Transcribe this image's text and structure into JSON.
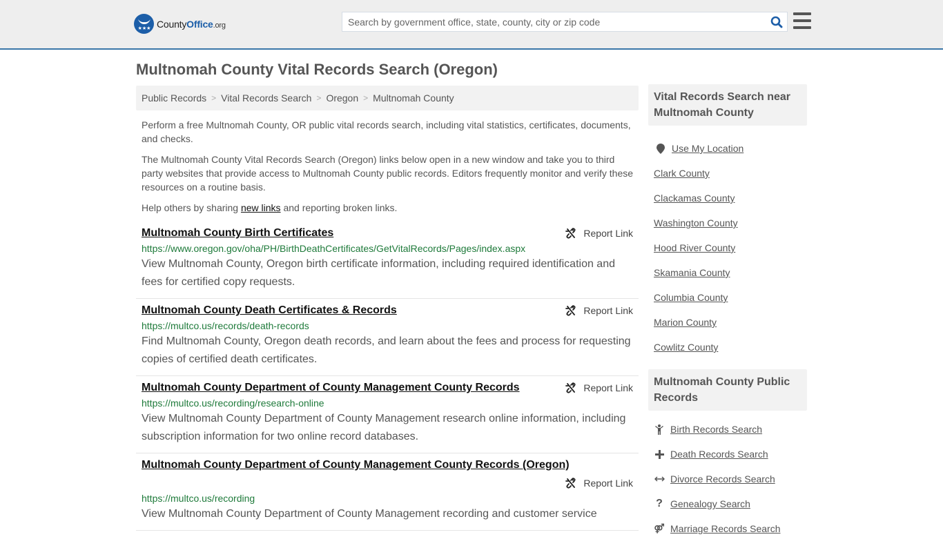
{
  "header": {
    "logo_text_a": "County",
    "logo_text_b": "Office",
    "logo_text_c": ".org",
    "search_placeholder": "Search by government office, state, county, city or zip code",
    "search_value": "",
    "brand_color": "#1c5ea8",
    "accent_border": "#3a77a8"
  },
  "page_title": "Multnomah County Vital Records Search (Oregon)",
  "breadcrumb": [
    "Public Records",
    "Vital Records Search",
    "Oregon",
    "Multnomah County"
  ],
  "intro": {
    "p1": "Perform a free Multnomah County, OR public vital records search, including vital statistics, certificates, documents, and checks.",
    "p2": "The Multnomah County Vital Records Search (Oregon) links below open in a new window and take you to third party websites that provide access to Multnomah County public records. Editors frequently monitor and verify these resources on a routine basis.",
    "p3_before": "Help others by sharing ",
    "p3_link": "new links",
    "p3_after": " and reporting broken links."
  },
  "report_label": "Report Link",
  "results": [
    {
      "title": "Multnomah County Birth Certificates",
      "url": "https://www.oregon.gov/oha/PH/BirthDeathCertificates/GetVitalRecords/Pages/index.aspx",
      "desc": "View Multnomah County, Oregon birth certificate information, including required identification and fees for certified copy requests."
    },
    {
      "title": "Multnomah County Death Certificates & Records",
      "url": "https://multco.us/records/death-records",
      "desc": "Find Multnomah County, Oregon death records, and learn about the fees and process for requesting copies of certified death certificates."
    },
    {
      "title": "Multnomah County Department of County Management County Records",
      "url": "https://multco.us/recording/research-online",
      "desc": "View Multnomah County Department of County Management research online information, including subscription information for two online record databases."
    },
    {
      "title": "Multnomah County Department of County Management County Records (Oregon)",
      "url": "https://multco.us/recording",
      "desc": "View Multnomah County Department of County Management recording and customer service"
    }
  ],
  "sidebar": {
    "nearby_heading": "Vital Records Search near Multnomah County",
    "use_location": "Use My Location",
    "nearby": [
      "Clark County",
      "Clackamas County",
      "Washington County",
      "Hood River County",
      "Skamania County",
      "Columbia County",
      "Marion County",
      "Cowlitz County"
    ],
    "public_heading": "Multnomah County Public Records",
    "public_links": [
      {
        "label": "Birth Records Search",
        "icon": "child-icon"
      },
      {
        "label": "Death Records Search",
        "icon": "plus-icon"
      },
      {
        "label": "Divorce Records Search",
        "icon": "arrows-horizontal-icon"
      },
      {
        "label": "Genealogy Search",
        "icon": "question-icon"
      },
      {
        "label": "Marriage Records Search",
        "icon": "marriage-icon"
      }
    ]
  }
}
